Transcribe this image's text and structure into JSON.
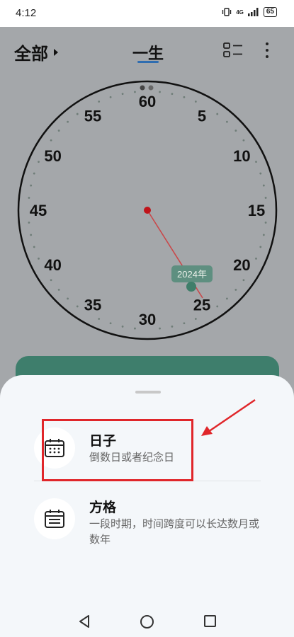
{
  "status_bar": {
    "time": "4:12",
    "signal": "4G",
    "battery": "65"
  },
  "top_bar": {
    "filter_label": "全部",
    "mode_label": "一生"
  },
  "dial": {
    "labels": [
      "60",
      "5",
      "10",
      "15",
      "20",
      "25",
      "30",
      "35",
      "40",
      "45",
      "50",
      "55"
    ],
    "current_year_badge": "2024年"
  },
  "sheet": {
    "options": [
      {
        "title": "日子",
        "description": "倒数日或者纪念日"
      },
      {
        "title": "方格",
        "description": "一段时期，时间跨度可以长达数月或数年"
      }
    ]
  },
  "colors": {
    "accent_green": "#3e7e6c",
    "highlight_red": "#e0262a",
    "tab_underline": "#2f6db0"
  }
}
